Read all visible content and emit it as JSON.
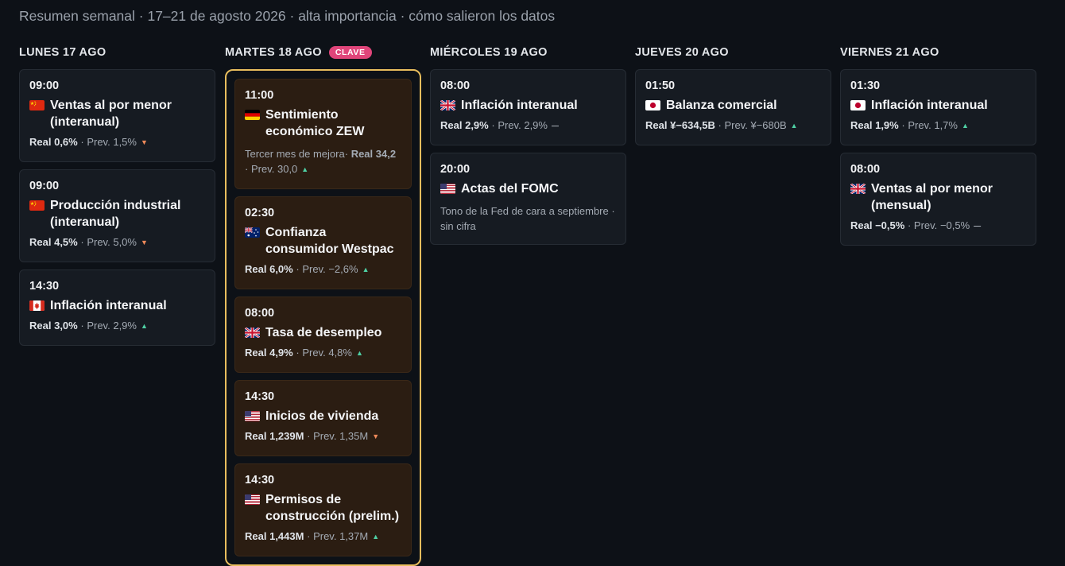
{
  "header": {
    "title": "Resumen semanal · 17–21 de agosto 2026 · alta importancia · cómo salieron los datos"
  },
  "labels": {
    "real": "Real",
    "prev": "Prev.",
    "sep": "·"
  },
  "colors": {
    "background": "#0d1117",
    "card": "#161b22",
    "key_card": "#2b1d12",
    "key_border": "#e8bd5d",
    "badge": "#e0457a",
    "up": "#4fd0a4",
    "down": "#f08a5a"
  },
  "days": [
    {
      "label": "LUNES 17 AGO",
      "badge": "",
      "events": [
        {
          "time": "09:00",
          "flag": "cn-flag-icon",
          "title": "Ventas al por menor (interanual)",
          "note": "",
          "actual": "0,6%",
          "previous": "1,5%",
          "direction": "down"
        },
        {
          "time": "09:00",
          "flag": "cn-flag-icon",
          "title": "Producción industrial (interanual)",
          "note": "",
          "actual": "4,5%",
          "previous": "5,0%",
          "direction": "down"
        },
        {
          "time": "14:30",
          "flag": "ca-flag-icon",
          "title": "Inflación interanual",
          "note": "",
          "actual": "3,0%",
          "previous": "2,9%",
          "direction": "up"
        }
      ]
    },
    {
      "label": "MARTES 18 AGO",
      "badge": "CLAVE",
      "events": [
        {
          "time": "11:00",
          "flag": "de-flag-icon",
          "title": "Sentimiento económico ZEW",
          "note": "Tercer mes de mejora",
          "actual": "34,2",
          "previous": "30,0",
          "direction": "up"
        },
        {
          "time": "02:30",
          "flag": "au-flag-icon",
          "title": "Confianza consumidor Westpac",
          "note": "",
          "actual": "6,0%",
          "previous": "−2,6%",
          "direction": "up"
        },
        {
          "time": "08:00",
          "flag": "gb-flag-icon",
          "title": "Tasa de desempleo",
          "note": "",
          "actual": "4,9%",
          "previous": "4,8%",
          "direction": "up"
        },
        {
          "time": "14:30",
          "flag": "us-flag-icon",
          "title": "Inicios de vivienda",
          "note": "",
          "actual": "1,239M",
          "previous": "1,35M",
          "direction": "down"
        },
        {
          "time": "14:30",
          "flag": "us-flag-icon",
          "title": "Permisos de construcción (prelim.)",
          "note": "",
          "actual": "1,443M",
          "previous": "1,37M",
          "direction": "up"
        }
      ]
    },
    {
      "label": "MIÉRCOLES 19 AGO",
      "badge": "",
      "events": [
        {
          "time": "08:00",
          "flag": "gb-flag-icon",
          "title": "Inflación interanual",
          "note": "",
          "actual": "2,9%",
          "previous": "2,9%",
          "direction": "flat"
        },
        {
          "time": "20:00",
          "flag": "us-flag-icon",
          "title": "Actas del FOMC",
          "note": "Tono de la Fed de cara a septiembre · sin cifra",
          "actual": "",
          "previous": "",
          "direction": ""
        }
      ]
    },
    {
      "label": "JUEVES 20 AGO",
      "badge": "",
      "events": [
        {
          "time": "01:50",
          "flag": "jp-flag-icon",
          "title": "Balanza comercial",
          "note": "",
          "actual": "¥−634,5B",
          "previous": "¥−680B",
          "direction": "up"
        }
      ]
    },
    {
      "label": "VIERNES 21 AGO",
      "badge": "",
      "events": [
        {
          "time": "01:30",
          "flag": "jp-flag-icon",
          "title": "Inflación interanual",
          "note": "",
          "actual": "1,9%",
          "previous": "1,7%",
          "direction": "up"
        },
        {
          "time": "08:00",
          "flag": "gb-flag-icon",
          "title": "Ventas al por menor (mensual)",
          "note": "",
          "actual": "−0,5%",
          "previous": "−0,5%",
          "direction": "flat"
        }
      ]
    }
  ]
}
